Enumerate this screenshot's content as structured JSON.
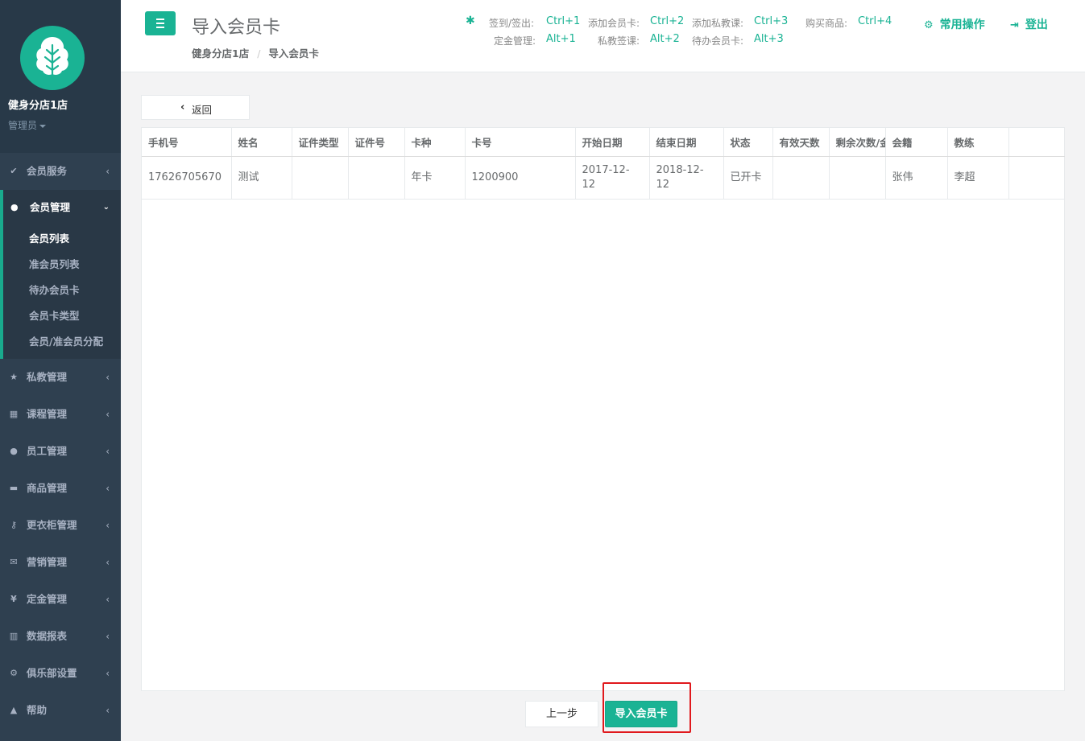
{
  "sidebar": {
    "club_name": "健身分店1店",
    "role": "管理员",
    "nav": [
      {
        "icon": "check-icon",
        "label": "会员服务"
      },
      {
        "icon": "user-icon",
        "label": "会员管理"
      },
      {
        "icon": "star-icon",
        "label": "私教管理"
      },
      {
        "icon": "calendar-icon",
        "label": "课程管理"
      },
      {
        "icon": "users-icon",
        "label": "员工管理"
      },
      {
        "icon": "cart-icon",
        "label": "商品管理"
      },
      {
        "icon": "key-icon",
        "label": "更衣柜管理"
      },
      {
        "icon": "envelope-icon",
        "label": "营销管理"
      },
      {
        "icon": "yen-icon",
        "label": "定金管理"
      },
      {
        "icon": "bar-chart-icon",
        "label": "数据报表"
      },
      {
        "icon": "cog-icon",
        "label": "俱乐部设置"
      },
      {
        "icon": "graduation-cap-icon",
        "label": "帮助"
      }
    ],
    "submenu": [
      "会员列表",
      "准会员列表",
      "待办会员卡",
      "会员卡类型",
      "会员/准会员分配"
    ],
    "active_submenu": "会员列表"
  },
  "header": {
    "title": "导入会员卡",
    "breadcrumb": [
      "健身分店1店",
      "导入会员卡"
    ],
    "shortcuts": [
      {
        "label": "签到/签出:",
        "key": "Ctrl+1"
      },
      {
        "label": "添加会员卡:",
        "key": "Ctrl+2"
      },
      {
        "label": "添加私教课:",
        "key": "Ctrl+3"
      },
      {
        "label": "购买商品:",
        "key": "Ctrl+4"
      },
      {
        "label": "定金管理:",
        "key": "Alt+1"
      },
      {
        "label": "私教签课:",
        "key": "Alt+2"
      },
      {
        "label": "待办会员卡:",
        "key": "Alt+3"
      }
    ],
    "common_ops": "常用操作",
    "logout": "登出"
  },
  "back_label": "返回",
  "table": {
    "columns": [
      "手机号",
      "姓名",
      "证件类型",
      "证件号",
      "卡种",
      "卡号",
      "开始日期",
      "结束日期",
      "状态",
      "有效天数",
      "剩余次数/金额",
      "会籍",
      "教练",
      ""
    ],
    "rows": [
      [
        "17626705670",
        "测试",
        "",
        "",
        "年卡",
        "1200900",
        "2017-12-12",
        "2018-12-12",
        "已开卡",
        "",
        "",
        "张伟",
        "李超",
        ""
      ]
    ]
  },
  "footer": {
    "prev_label": "上一步",
    "import_label": "导入会员卡"
  },
  "colors": {
    "accent": "#1ab394",
    "sidebar": "#2f4050",
    "highlight": "#e0191d"
  }
}
